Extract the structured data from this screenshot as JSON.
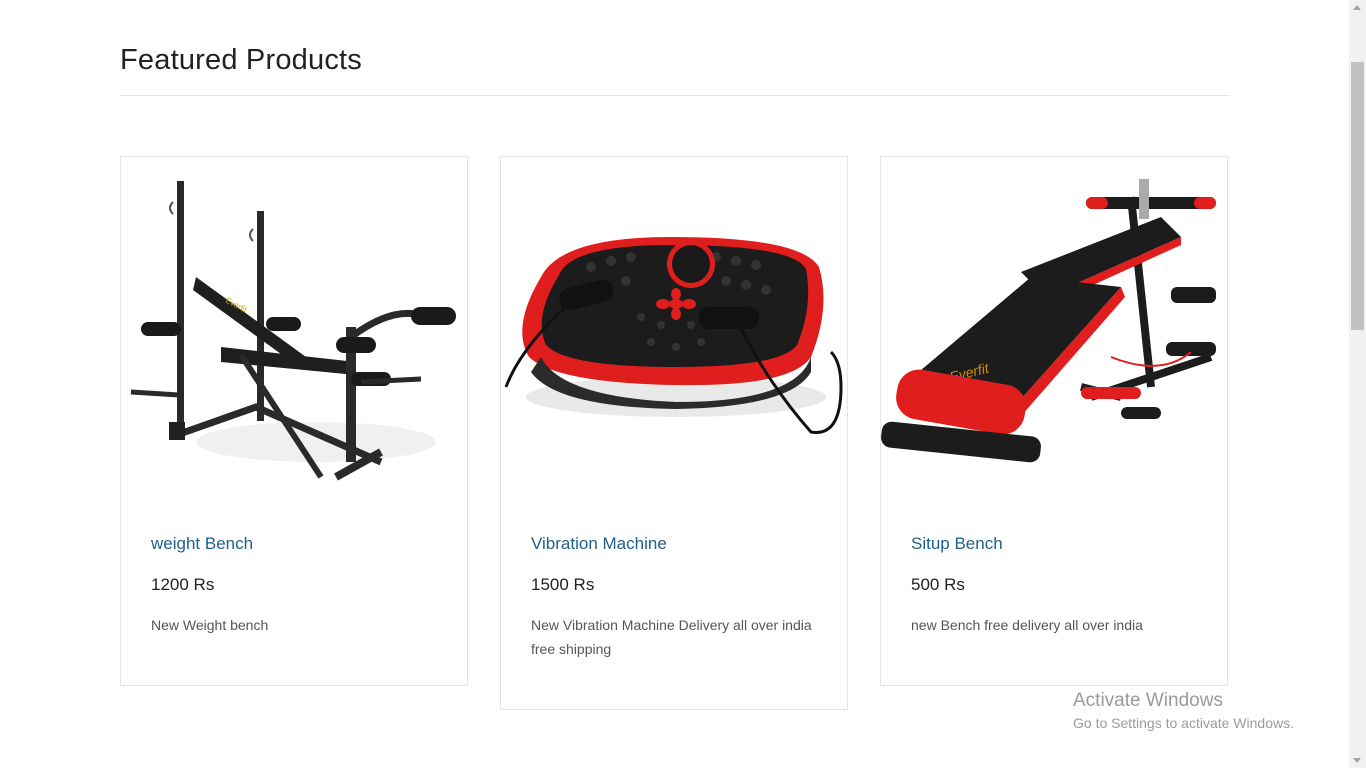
{
  "section": {
    "title": "Featured Products"
  },
  "products": [
    {
      "name": "weight Bench",
      "price": "1200 Rs",
      "description": "New Weight bench",
      "image": "weight-bench-image"
    },
    {
      "name": "Vibration Machine",
      "price": "1500 Rs",
      "description": "New Vibration Machine Delivery all over india free shipping",
      "image": "vibration-machine-image"
    },
    {
      "name": "Situp Bench",
      "price": "500 Rs",
      "description": "new Bench free delivery all over india",
      "image": "situp-bench-image"
    }
  ],
  "watermark": {
    "line1": "Activate Windows",
    "line2": "Go to Settings to activate Windows."
  },
  "colors": {
    "link": "#1f5f8b",
    "accent_red": "#e01e1e",
    "equipment_black": "#1c1c1c"
  }
}
